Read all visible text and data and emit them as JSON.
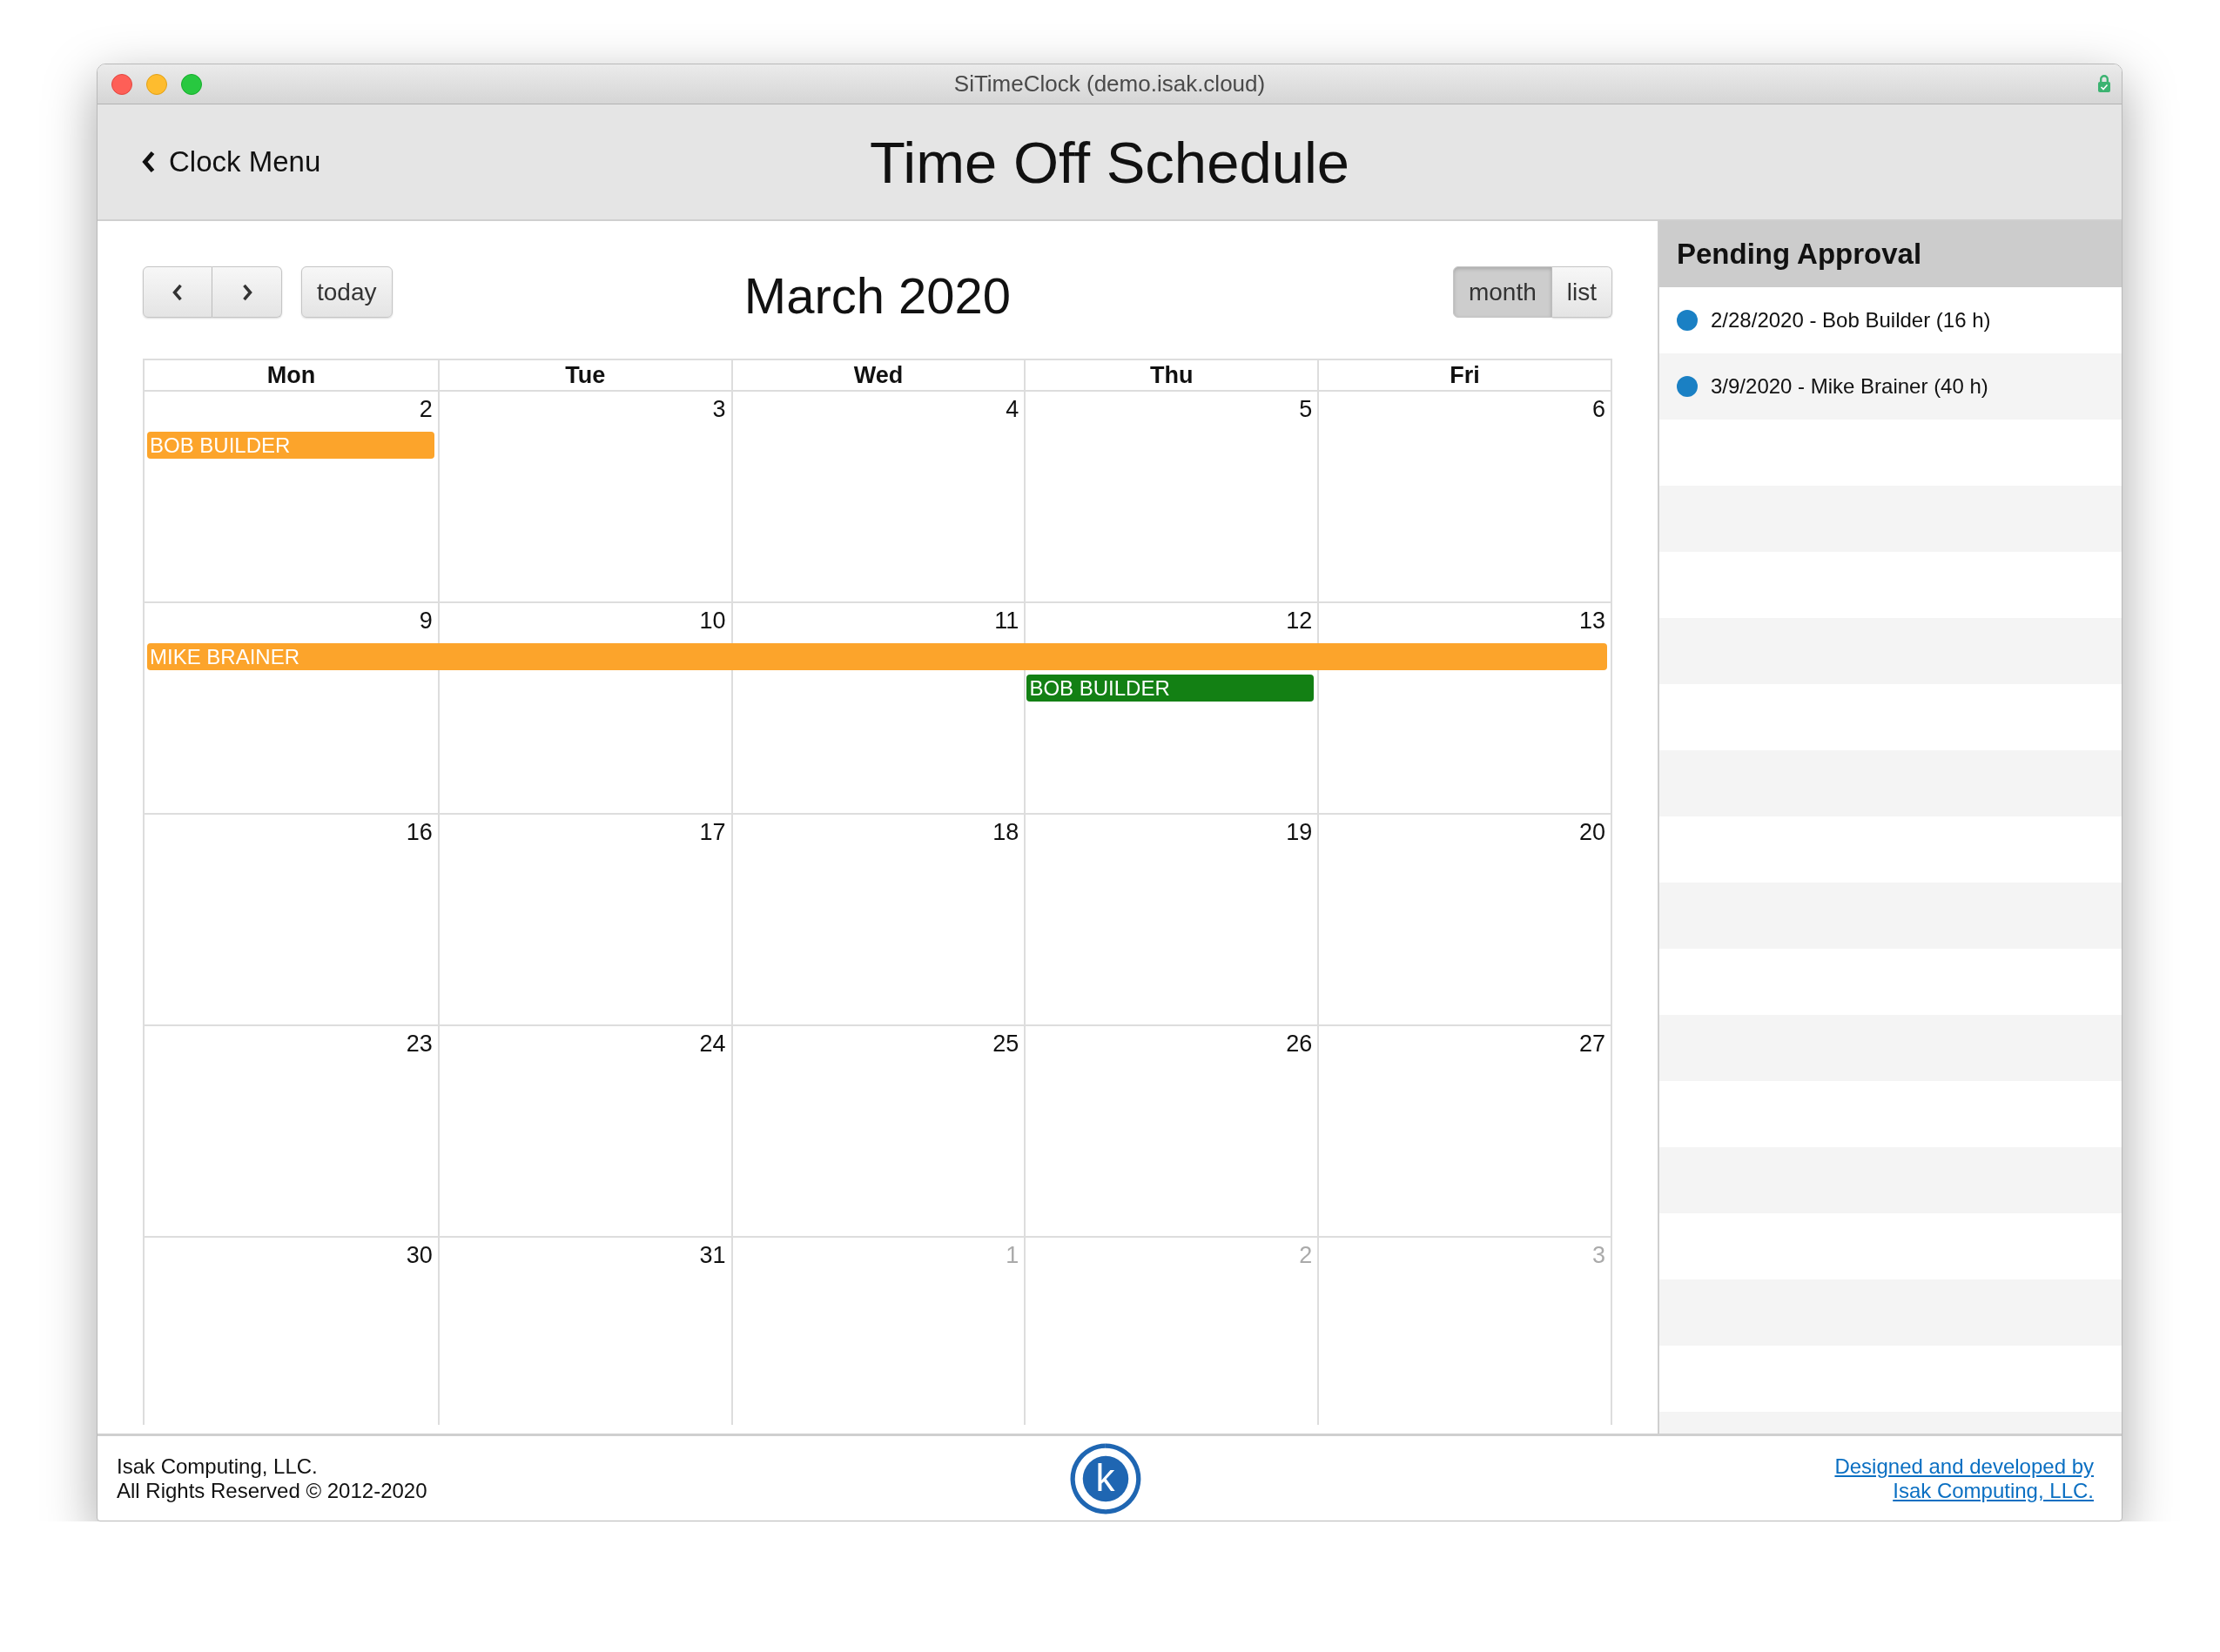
{
  "window": {
    "title": "SiTimeClock (demo.isak.cloud)"
  },
  "header": {
    "back_label": "Clock Menu",
    "title": "Time Off Schedule"
  },
  "calendar": {
    "today_label": "today",
    "title": "March 2020",
    "views": [
      {
        "label": "month",
        "selected": true
      },
      {
        "label": "list",
        "selected": false
      }
    ],
    "weekdays": [
      "Mon",
      "Tue",
      "Wed",
      "Thu",
      "Fri"
    ],
    "weeks": [
      {
        "days": [
          {
            "label": "2",
            "other_month": false
          },
          {
            "label": "3",
            "other_month": false
          },
          {
            "label": "4",
            "other_month": false
          },
          {
            "label": "5",
            "other_month": false
          },
          {
            "label": "6",
            "other_month": false
          }
        ],
        "lanes": [
          [
            {
              "kind": "event",
              "title": "BOB BUILDER",
              "color": "#fca42b"
            },
            {
              "kind": "gap"
            },
            {
              "kind": "gap"
            },
            {
              "kind": "gap"
            },
            {
              "kind": "gap"
            }
          ]
        ]
      },
      {
        "days": [
          {
            "label": "9",
            "other_month": false
          },
          {
            "label": "10",
            "other_month": false
          },
          {
            "label": "11",
            "other_month": false
          },
          {
            "label": "12",
            "other_month": false
          },
          {
            "label": "13",
            "other_month": false
          }
        ],
        "lanes": [
          [
            {
              "kind": "event",
              "title": "MIKE BRAINER",
              "color": "#fca42b"
            },
            {
              "kind": "continued"
            },
            {
              "kind": "continued"
            },
            {
              "kind": "continued"
            },
            {
              "kind": "continued"
            }
          ],
          [
            {
              "kind": "gap"
            },
            {
              "kind": "gap"
            },
            {
              "kind": "gap"
            },
            {
              "kind": "event",
              "title": "BOB BUILDER",
              "color": "#138014"
            },
            {
              "kind": "gap"
            }
          ]
        ]
      },
      {
        "days": [
          {
            "label": "16",
            "other_month": false
          },
          {
            "label": "17",
            "other_month": false
          },
          {
            "label": "18",
            "other_month": false
          },
          {
            "label": "19",
            "other_month": false
          },
          {
            "label": "20",
            "other_month": false
          }
        ]
      },
      {
        "days": [
          {
            "label": "23",
            "other_month": false
          },
          {
            "label": "24",
            "other_month": false
          },
          {
            "label": "25",
            "other_month": false
          },
          {
            "label": "26",
            "other_month": false
          },
          {
            "label": "27",
            "other_month": false
          }
        ]
      },
      {
        "days": [
          {
            "label": "30",
            "other_month": false
          },
          {
            "label": "31",
            "other_month": false
          },
          {
            "label": "1",
            "other_month": true
          },
          {
            "label": "2",
            "other_month": true
          },
          {
            "label": "3",
            "other_month": true
          }
        ]
      }
    ]
  },
  "pending": {
    "title": "Pending Approval",
    "items": [
      {
        "text": "2/28/2020 - Bob Builder (16 h)"
      },
      {
        "text": "3/9/2020 - Mike Brainer (40 h)"
      }
    ]
  },
  "footer": {
    "company": "Isak Computing, LLC.",
    "rights": "All Rights Reserved © 2012-2020",
    "logo_letter": "k",
    "credit_lines": [
      "Designed and developed by",
      "Isak Computing, LLC."
    ]
  }
}
